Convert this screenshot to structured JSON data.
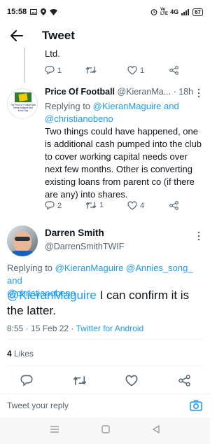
{
  "status_bar": {
    "time": "15:58",
    "network": "Vo LTE",
    "signal": "4G",
    "battery": "67"
  },
  "header": {
    "title": "Tweet"
  },
  "prev_tweet": {
    "text_tail": "Ltd.",
    "replies": "1",
    "likes": "1"
  },
  "pof_tweet": {
    "display_name": "Price Of Football",
    "handle": "@KieranMa...",
    "time": "· 18h",
    "avatar_text": "The Price of Football with Kieran Maguire and Kevin Day",
    "replying_prefix": "Replying to ",
    "replying_to": "@KieranMaguire and @christianobeno",
    "text": "Two things could have happened, one is additional cash pumped into the club to cover working capital needs over next few months. Other is converting existing loans from parent co (if there are any) into shares.",
    "replies": "2",
    "retweets": "1",
    "likes": "4"
  },
  "main_tweet": {
    "display_name": "Darren Smith",
    "handle": "@DarrenSmithTWIF",
    "replying_prefix": "Replying to ",
    "replying_to_1": "@KieranMaguire @Annies_song_ and",
    "replying_to_2": "@christianobeno",
    "mention": "@KieranMaguire",
    "text_rest_1": " I can confirm it is",
    "text_rest_2": "the latter.",
    "timestamp": "8:55 · 15 Feb 22 · ",
    "client": "Twitter for Android",
    "likes_count": "4",
    "likes_label": "Likes"
  },
  "reply_box": {
    "placeholder": "Tweet your reply"
  },
  "colors": {
    "accent": "#1d9bf0",
    "muted": "#536471",
    "text": "#0f1419"
  }
}
